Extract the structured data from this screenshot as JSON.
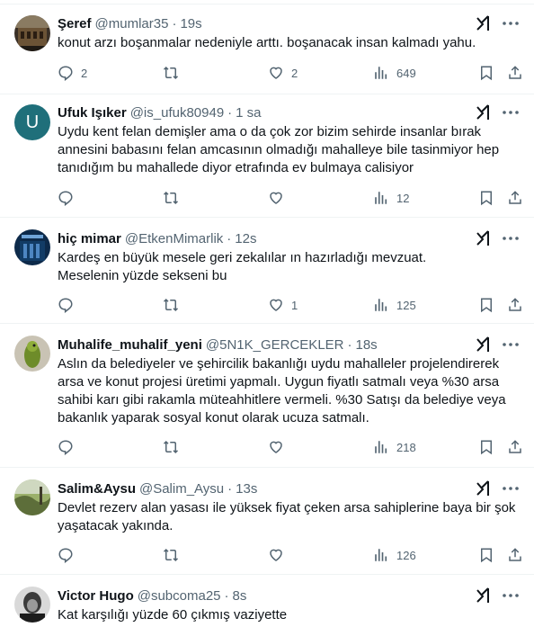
{
  "tweets": [
    {
      "name": "Şeref",
      "handle": "@mumlar35",
      "time": "19s",
      "text": "konut arzı boşanmalar nedeniyle arttı. boşanacak insan kalmadı yahu.",
      "replies": "2",
      "retweets": "",
      "likes": "2",
      "views": "649",
      "avatar": "photo-colosseum"
    },
    {
      "name": "Ufuk Işıker",
      "handle": "@is_ufuk80949",
      "time": "1 sa",
      "text": "Uydu kent felan demişler ama o da çok zor bizim sehirde  insanlar bırak\nannesini babasını felan amcasının olmadığı mahalleye bile tasinmiyor hep\ntanıdığım bu mahallede diyor etrafında ev bulmaya calisiyor",
      "replies": "",
      "retweets": "",
      "likes": "",
      "views": "12",
      "avatar_letter": "U",
      "avatar_color": "#1f6f7a"
    },
    {
      "name": "hiç mimar",
      "handle": "@EtkenMimarlik",
      "time": "12s",
      "text": "Kardeş en büyük mesele geri zekalılar ın hazırladığı mevzuat.\nMeselenin yüzde sekseni bu",
      "replies": "",
      "retweets": "",
      "likes": "1",
      "views": "125",
      "avatar": "photo-poster"
    },
    {
      "name": "Muhalife_muhalif_yeni",
      "handle": "@5N1K_GERCEKLER",
      "time": "18s",
      "text": "Aslın da belediyeler ve şehircilik bakanlığı uydu mahalleler projelendirerek\narsa ve konut projesi üretimi yapmalı. Uygun fiyatlı satmalı veya %30 arsa\nsahibi karı gibi rakamla müteahhitlere vermeli. %30 Satışı da belediye veya\nbakanlık yaparak sosyal konut olarak ucuza satmalı.",
      "replies": "",
      "retweets": "",
      "likes": "",
      "views": "218",
      "avatar": "photo-parrot"
    },
    {
      "name": "Salim&Aysu",
      "handle": "@Salim_Aysu",
      "time": "13s",
      "text": "Devlet rezerv alan yasası ile yüksek fiyat çeken arsa sahiplerine baya bir şok\nyaşatacak yakında.",
      "replies": "",
      "retweets": "",
      "likes": "",
      "views": "126",
      "avatar": "photo-landscape"
    },
    {
      "name": "Victor Hugo",
      "handle": "@subcoma25",
      "time": "8s",
      "text": "Kat karşılığı yüzde 60 çıkmış vaziyette",
      "replies": "",
      "retweets": "",
      "likes": "",
      "views": "",
      "avatar": "photo-portrait-bw"
    }
  ],
  "colors": {
    "text": "#0f1419",
    "muted": "#536471",
    "border": "#eff3f4"
  }
}
